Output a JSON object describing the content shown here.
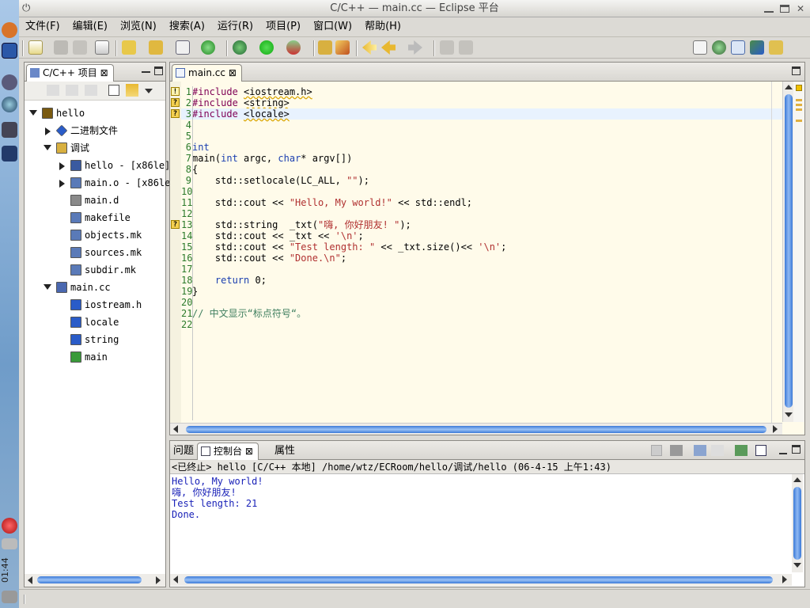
{
  "window": {
    "title": "C/C++ — main.cc — Eclipse 平台"
  },
  "desktop": {
    "clock": "01:44"
  },
  "menu": [
    "文件(F)",
    "编辑(E)",
    "浏览(N)",
    "搜索(A)",
    "运行(R)",
    "项目(P)",
    "窗口(W)",
    "帮助(H)"
  ],
  "project_view": {
    "tab_label": "C/C++ 项目",
    "tree": [
      {
        "label": "hello",
        "depth": 0,
        "twisty": "open",
        "icon": "project-icon",
        "color": "#7a5a10"
      },
      {
        "label": "二进制文件",
        "depth": 1,
        "twisty": "closed",
        "icon": "binaries-icon",
        "color": "#2a5cc8"
      },
      {
        "label": "调试",
        "depth": 1,
        "twisty": "open",
        "icon": "folder-icon",
        "color": "#d8b040"
      },
      {
        "label": "hello - [x86le]",
        "depth": 2,
        "twisty": "closed",
        "icon": "executable-icon",
        "color": "#3a5aa0"
      },
      {
        "label": "main.o - [x86le]",
        "depth": 2,
        "twisty": "closed",
        "icon": "object-file-icon",
        "color": "#5a7ab8"
      },
      {
        "label": "main.d",
        "depth": 2,
        "twisty": "",
        "icon": "file-icon",
        "color": "#8a8a8a"
      },
      {
        "label": "makefile",
        "depth": 2,
        "twisty": "",
        "icon": "make-file-icon",
        "color": "#5a7ab8"
      },
      {
        "label": "objects.mk",
        "depth": 2,
        "twisty": "",
        "icon": "make-file-icon",
        "color": "#5a7ab8"
      },
      {
        "label": "sources.mk",
        "depth": 2,
        "twisty": "",
        "icon": "make-file-icon",
        "color": "#5a7ab8"
      },
      {
        "label": "subdir.mk",
        "depth": 2,
        "twisty": "",
        "icon": "make-file-icon",
        "color": "#5a7ab8"
      },
      {
        "label": "main.cc",
        "depth": 1,
        "twisty": "open",
        "icon": "cpp-source-icon",
        "color": "#4a68b0"
      },
      {
        "label": "iostream.h",
        "depth": 2,
        "twisty": "",
        "icon": "include-icon",
        "color": "#2a5cc8"
      },
      {
        "label": "locale",
        "depth": 2,
        "twisty": "",
        "icon": "include-icon",
        "color": "#2a5cc8"
      },
      {
        "label": "string",
        "depth": 2,
        "twisty": "",
        "icon": "include-icon",
        "color": "#2a5cc8"
      },
      {
        "label": "main",
        "depth": 2,
        "twisty": "",
        "icon": "function-icon",
        "color": "#3a9a3a"
      }
    ]
  },
  "editor": {
    "tab_label": "main.cc",
    "lines": [
      {
        "n": "1",
        "text": "#include <iostream.h>",
        "marker": "warning"
      },
      {
        "n": "2",
        "text": "#include <string>",
        "marker": "question"
      },
      {
        "n": "3",
        "text": "#include <locale>",
        "marker": "question"
      },
      {
        "n": "4",
        "text": "",
        "marker": ""
      },
      {
        "n": "5",
        "text": "",
        "marker": ""
      },
      {
        "n": "6",
        "text": "int",
        "marker": ""
      },
      {
        "n": "7",
        "text": "main(int argc, char* argv[])",
        "marker": ""
      },
      {
        "n": "8",
        "text": "{",
        "marker": ""
      },
      {
        "n": "9",
        "text": "    std::setlocale(LC_ALL, \"\");",
        "marker": ""
      },
      {
        "n": "10",
        "text": "",
        "marker": ""
      },
      {
        "n": "11",
        "text": "    std::cout << \"Hello, My world!\" << std::endl;",
        "marker": ""
      },
      {
        "n": "12",
        "text": "",
        "marker": ""
      },
      {
        "n": "13",
        "text": "    std::string  _txt(\"嗨, 你好朋友! \");",
        "marker": "question"
      },
      {
        "n": "14",
        "text": "    std::cout << _txt << '\\n';",
        "marker": ""
      },
      {
        "n": "15",
        "text": "    std::cout << \"Test length: \" << _txt.size()<< '\\n';",
        "marker": ""
      },
      {
        "n": "16",
        "text": "    std::cout << \"Done.\\n\";",
        "marker": ""
      },
      {
        "n": "17",
        "text": "",
        "marker": ""
      },
      {
        "n": "18",
        "text": "    return 0;",
        "marker": ""
      },
      {
        "n": "19",
        "text": "}",
        "marker": ""
      },
      {
        "n": "20",
        "text": "",
        "marker": ""
      },
      {
        "n": "21",
        "text": "// 中文显示“标点符号“。",
        "marker": ""
      },
      {
        "n": "22",
        "text": "",
        "marker": ""
      }
    ]
  },
  "console": {
    "tabs": [
      "问题",
      "控制台",
      "属性"
    ],
    "active_tab": 1,
    "header": "<已终止> hello [C/C++ 本地] /home/wtz/ECRoom/hello/调试/hello (06-4-15 上午1:43)",
    "output": [
      "Hello, My world!",
      "嗨, 你好朋友!",
      "Test length: 21",
      "Done."
    ]
  }
}
